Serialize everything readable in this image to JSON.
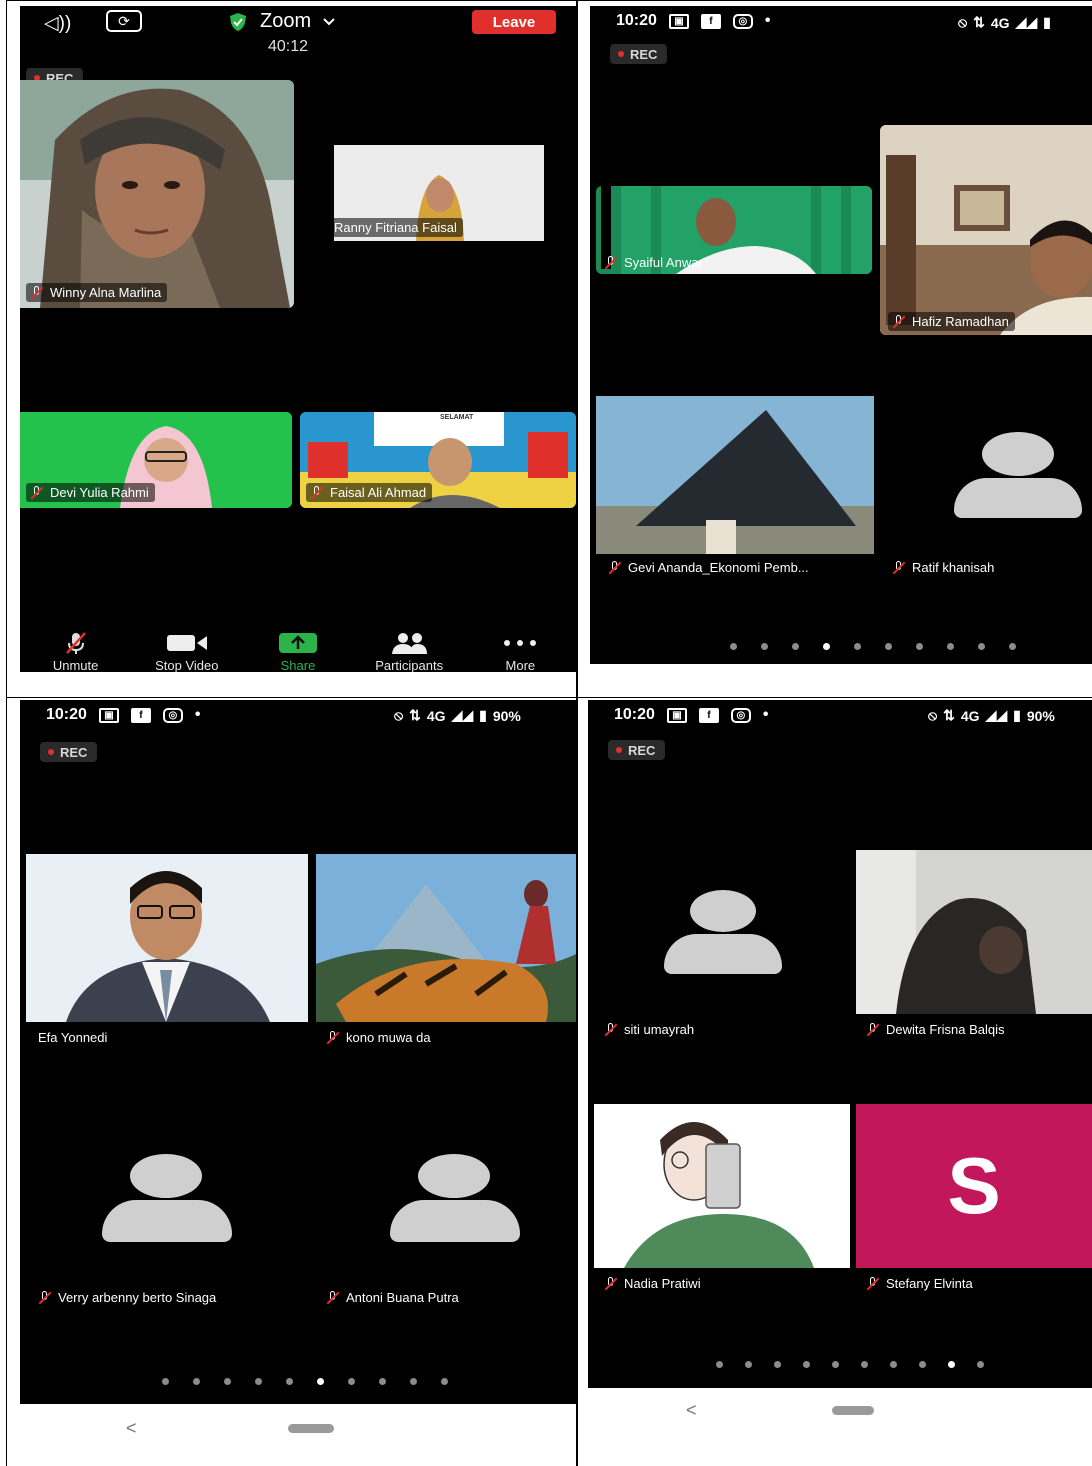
{
  "panel1": {
    "speaker_label": "◁))",
    "camera_flip_label": "⟳",
    "app_title": "Zoom",
    "timer": "40:12",
    "leave_label": "Leave",
    "rec_label": "REC",
    "participants": [
      {
        "name": "Winny Alna Marlina"
      },
      {
        "name": "Ranny Fitriana Faisal"
      },
      {
        "name": "Devi Yulia Rahmi"
      },
      {
        "name": "Faisal Ali Ahmad"
      }
    ],
    "video_caption": "SELAMAT",
    "toolbar": [
      {
        "label": "Unmute",
        "icon": "mic-off-icon"
      },
      {
        "label": "Stop Video",
        "icon": "video-camera-icon"
      },
      {
        "label": "Share",
        "icon": "share-arrow-icon"
      },
      {
        "label": "Participants",
        "icon": "participants-icon"
      },
      {
        "label": "More",
        "icon": "more-dots-icon"
      }
    ]
  },
  "panel2": {
    "time": "10:20",
    "network": "4G",
    "rec_label": "REC",
    "participants": [
      {
        "name": "Syaiful Anwar"
      },
      {
        "name": "Hafiz Ramadhan"
      },
      {
        "name": "Gevi Ananda_Ekonomi Pemb..."
      },
      {
        "name": "Ratif khanisah"
      }
    ],
    "page_count": 10,
    "active_page": 4
  },
  "panel3": {
    "time": "10:20",
    "network": "4G",
    "battery": "90%",
    "rec_label": "REC",
    "participants": [
      {
        "name": "Efa Yonnedi"
      },
      {
        "name": "kono muwa da"
      },
      {
        "name": "Verry arbenny berto Sinaga"
      },
      {
        "name": "Antoni Buana Putra"
      }
    ],
    "page_count": 10,
    "active_page": 6,
    "back_label": "<"
  },
  "panel4": {
    "time": "10:20",
    "network": "4G",
    "battery": "90%",
    "rec_label": "REC",
    "participants": [
      {
        "name": "siti umayrah"
      },
      {
        "name": "Dewita Frisna Balqis"
      },
      {
        "name": "Nadia Pratiwi"
      },
      {
        "name": "Stefany Elvinta",
        "initial": "S"
      }
    ],
    "page_count": 10,
    "active_page": 9,
    "back_label": "<"
  },
  "colors": {
    "leave": "#e0302b",
    "share": "#2cb34a",
    "shield": "#2cb34a",
    "stefany_tile": "#c2185b"
  }
}
